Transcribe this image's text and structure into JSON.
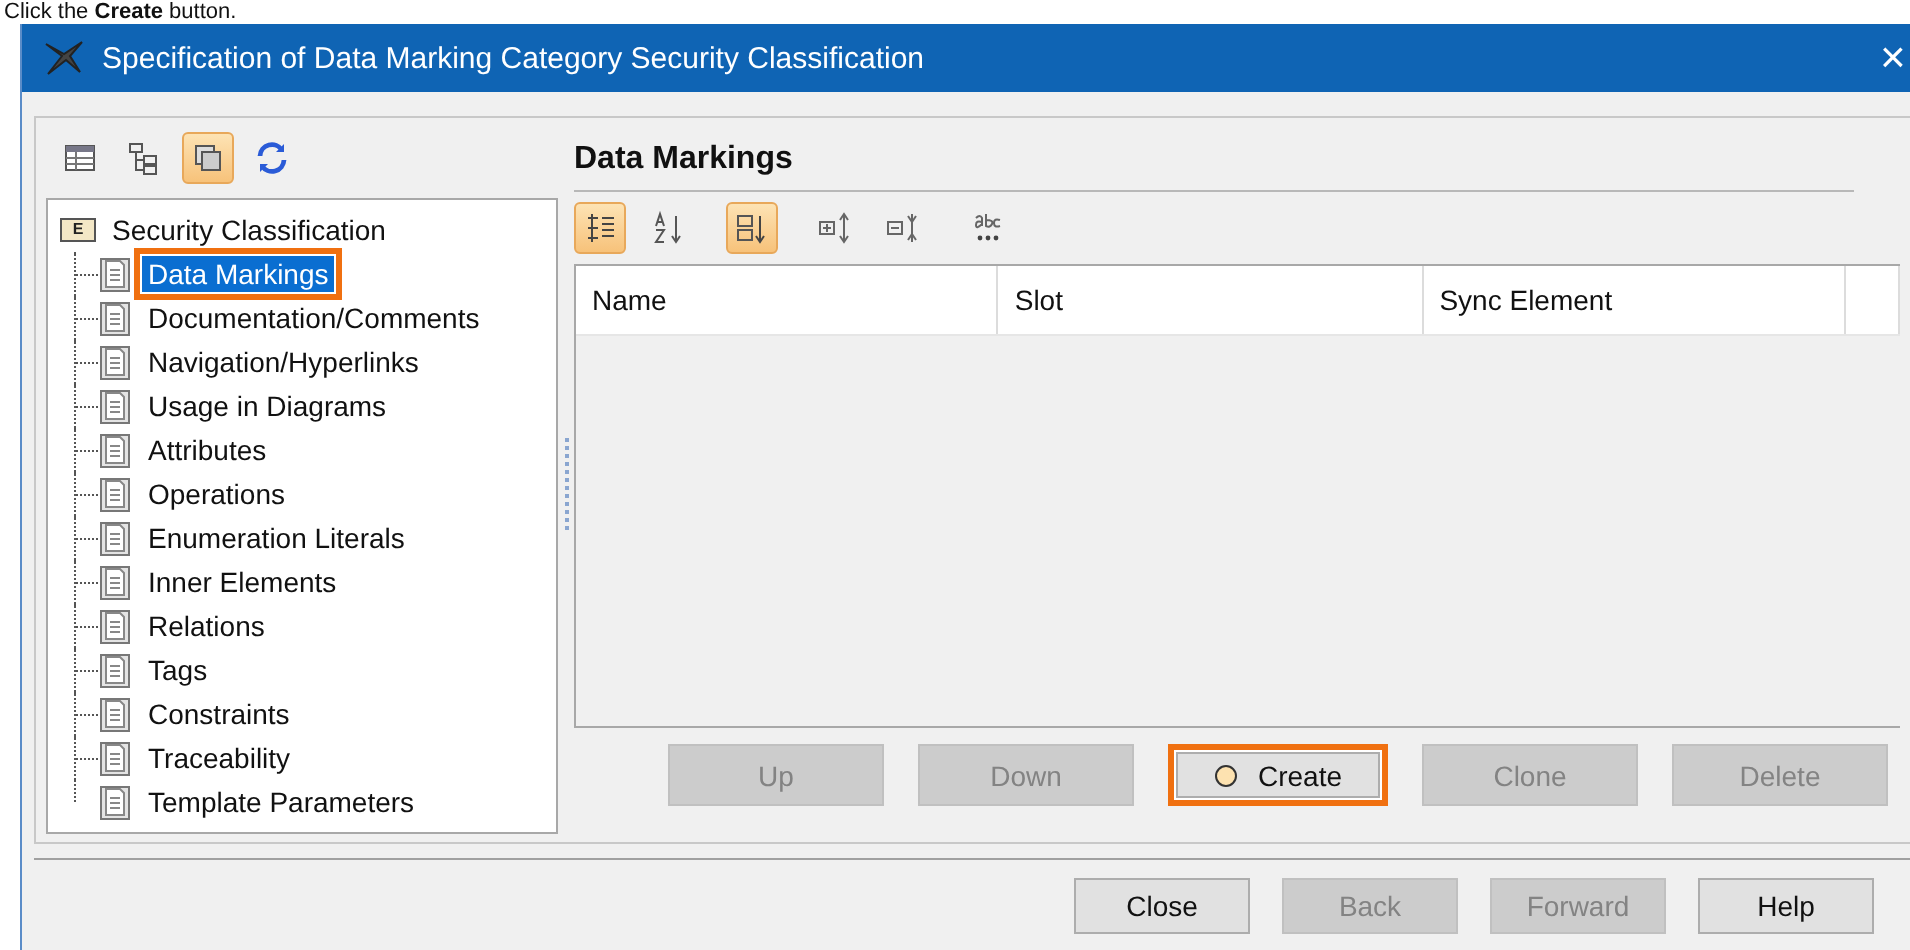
{
  "caption": "Click the **Create** button.",
  "window": {
    "title": "Specification of Data Marking Category Security Classification",
    "close": "×"
  },
  "left_toolbar": [
    {
      "kind": "table",
      "selected": false
    },
    {
      "kind": "tree",
      "selected": false
    },
    {
      "kind": "copies",
      "selected": true
    },
    {
      "kind": "refresh",
      "selected": false
    }
  ],
  "tree": {
    "label": "Security Classification",
    "badge": "E",
    "children": [
      {
        "label": "Data Markings",
        "selected": true,
        "highlighted": true
      },
      {
        "label": "Documentation/Comments",
        "selected": false,
        "highlighted": false
      },
      {
        "label": "Navigation/Hyperlinks",
        "selected": false,
        "highlighted": false
      },
      {
        "label": "Usage in Diagrams",
        "selected": false,
        "highlighted": false
      },
      {
        "label": "Attributes",
        "selected": false,
        "highlighted": false
      },
      {
        "label": "Operations",
        "selected": false,
        "highlighted": false
      },
      {
        "label": "Enumeration Literals",
        "selected": false,
        "highlighted": false
      },
      {
        "label": "Inner Elements",
        "selected": false,
        "highlighted": false
      },
      {
        "label": "Relations",
        "selected": false,
        "highlighted": false
      },
      {
        "label": "Tags",
        "selected": false,
        "highlighted": false
      },
      {
        "label": "Constraints",
        "selected": false,
        "highlighted": false
      },
      {
        "label": "Traceability",
        "selected": false,
        "highlighted": false
      },
      {
        "label": "Template Parameters",
        "selected": false,
        "highlighted": false
      }
    ]
  },
  "panel": {
    "title": "Data Markings"
  },
  "panel_toolbar": [
    {
      "kind": "group",
      "selected": true
    },
    {
      "kind": "sort-az",
      "selected": false
    },
    {
      "kind": "sort-down",
      "selected": true
    },
    {
      "kind": "expand",
      "selected": false
    },
    {
      "kind": "collapse",
      "selected": false
    },
    {
      "kind": "abc",
      "selected": false
    }
  ],
  "table": {
    "columns": [
      "Name",
      "Slot",
      "Sync Element"
    ]
  },
  "row_buttons": [
    {
      "label": "Up",
      "disabled": true,
      "highlighted": false,
      "icon": false
    },
    {
      "label": "Down",
      "disabled": true,
      "highlighted": false,
      "icon": false
    },
    {
      "label": "Create",
      "disabled": false,
      "highlighted": true,
      "icon": true
    },
    {
      "label": "Clone",
      "disabled": true,
      "highlighted": false,
      "icon": false
    },
    {
      "label": "Delete",
      "disabled": true,
      "highlighted": false,
      "icon": false
    }
  ],
  "dialog_buttons": [
    {
      "label": "Close",
      "disabled": false
    },
    {
      "label": "Back",
      "disabled": true
    },
    {
      "label": "Forward",
      "disabled": true
    },
    {
      "label": "Help",
      "disabled": false
    }
  ]
}
